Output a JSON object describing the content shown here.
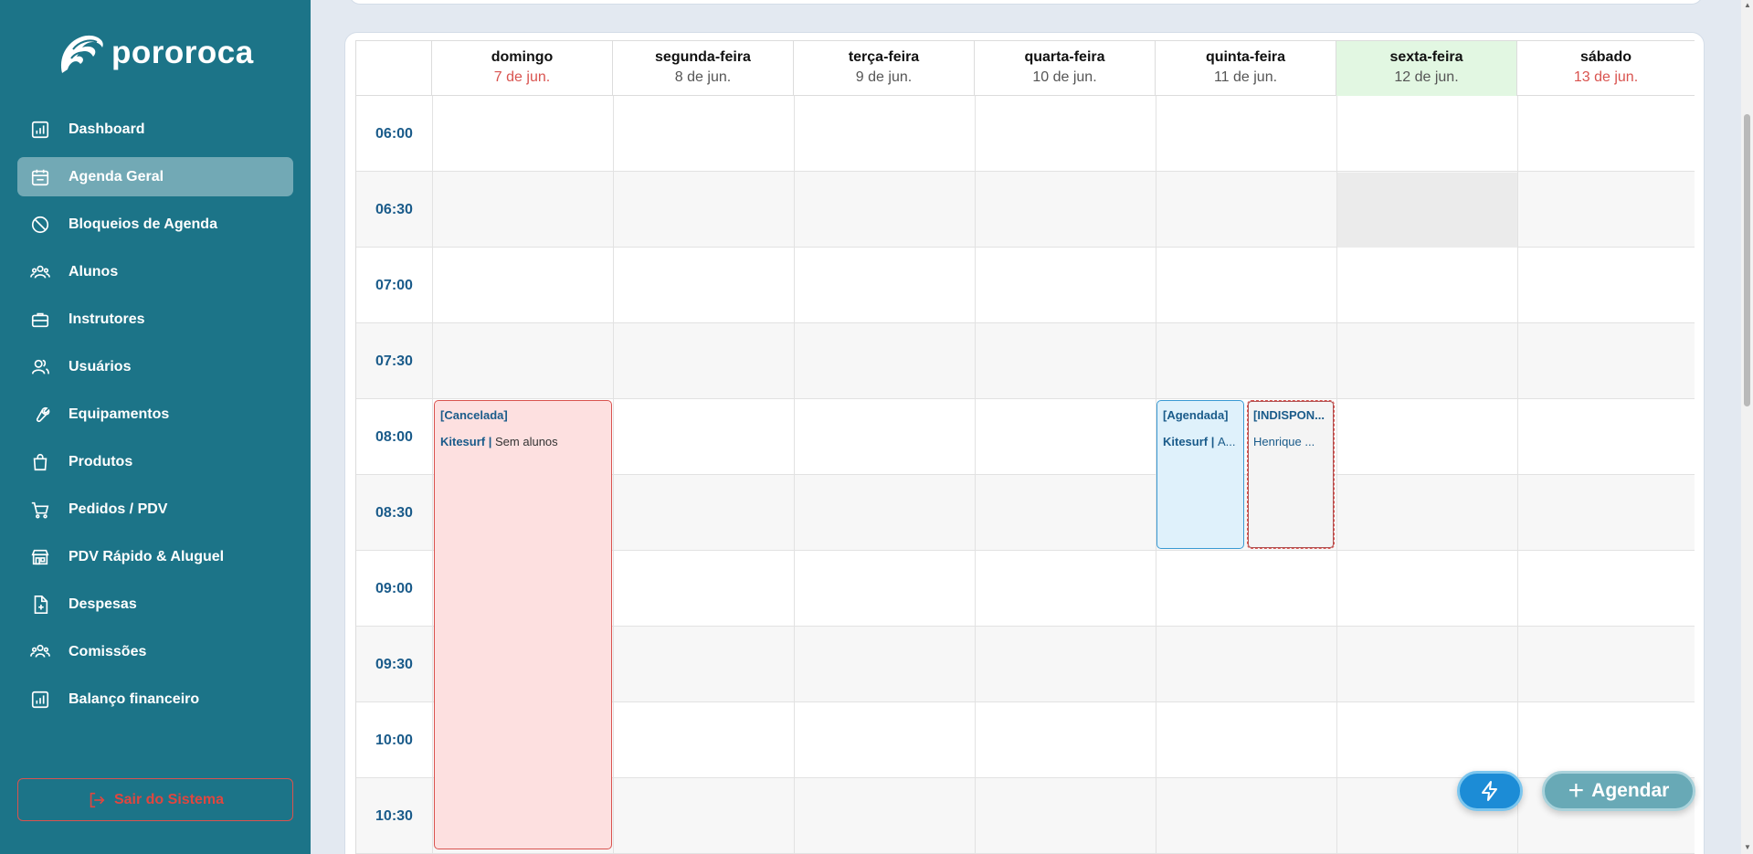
{
  "app": {
    "name": "pororoca"
  },
  "sidebar": {
    "items": [
      {
        "label": "Dashboard",
        "icon": "chart-icon",
        "active": false
      },
      {
        "label": "Agenda Geral",
        "icon": "calendar-icon",
        "active": true
      },
      {
        "label": "Bloqueios de Agenda",
        "icon": "block-icon",
        "active": false
      },
      {
        "label": "Alunos",
        "icon": "users-icon",
        "active": false
      },
      {
        "label": "Instrutores",
        "icon": "briefcase-icon",
        "active": false
      },
      {
        "label": "Usuários",
        "icon": "user-group-icon",
        "active": false
      },
      {
        "label": "Equipamentos",
        "icon": "wrench-icon",
        "active": false
      },
      {
        "label": "Produtos",
        "icon": "bag-icon",
        "active": false
      },
      {
        "label": "Pedidos / PDV",
        "icon": "cart-icon",
        "active": false
      },
      {
        "label": "PDV Rápido & Aluguel",
        "icon": "store-icon",
        "active": false
      },
      {
        "label": "Despesas",
        "icon": "file-plus-icon",
        "active": false
      },
      {
        "label": "Comissões",
        "icon": "team-icon",
        "active": false
      },
      {
        "label": "Balanço financeiro",
        "icon": "chart-icon",
        "active": false
      }
    ],
    "logout_label": "Sair do Sistema"
  },
  "calendar": {
    "days": [
      {
        "day": "domingo",
        "date": "7 de jun.",
        "weekend": true,
        "today": false
      },
      {
        "day": "segunda-feira",
        "date": "8 de jun.",
        "weekend": false,
        "today": false
      },
      {
        "day": "terça-feira",
        "date": "9 de jun.",
        "weekend": false,
        "today": false
      },
      {
        "day": "quarta-feira",
        "date": "10 de jun.",
        "weekend": false,
        "today": false
      },
      {
        "day": "quinta-feira",
        "date": "11 de jun.",
        "weekend": false,
        "today": false
      },
      {
        "day": "sexta-feira",
        "date": "12 de jun.",
        "weekend": false,
        "today": true
      },
      {
        "day": "sábado",
        "date": "13 de jun.",
        "weekend": true,
        "today": false
      }
    ],
    "times": [
      "06:00",
      "06:30",
      "07:00",
      "07:30",
      "08:00",
      "08:30",
      "09:00",
      "09:30",
      "10:00",
      "10:30"
    ],
    "events": [
      {
        "status": "[Cancelada]",
        "activity": "Kitesurf",
        "info": "Sem alunos",
        "type": "cancel"
      },
      {
        "status": "[Agendada]",
        "activity": "Kitesurf",
        "info": "A...",
        "type": "sched"
      },
      {
        "status": "[INDISPON...",
        "activity": "",
        "info": "Henrique ...",
        "type": "unavail"
      }
    ]
  },
  "actions": {
    "quick_icon": "lightning-icon",
    "agendar_label": "Agendar"
  },
  "colors": {
    "sidebar_bg": "#1c7488",
    "accent": "#1a5b8a",
    "cancel": "#d9534f",
    "today_bg": "#e2f7e2"
  }
}
